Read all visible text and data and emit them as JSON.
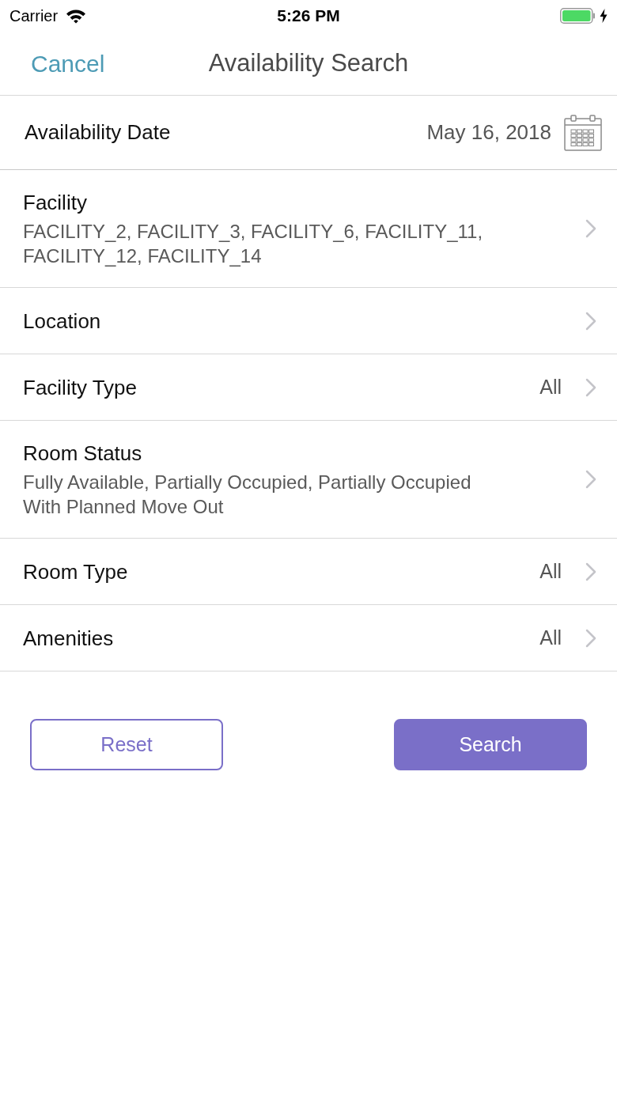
{
  "status_bar": {
    "carrier": "Carrier",
    "time": "5:26 PM"
  },
  "nav": {
    "cancel": "Cancel",
    "title": "Availability Search"
  },
  "date_row": {
    "label": "Availability Date",
    "value": "May 16, 2018"
  },
  "filters": [
    {
      "label": "Facility",
      "detail": "FACILITY_2, FACILITY_3, FACILITY_6, FACILITY_11, FACILITY_12, FACILITY_14"
    },
    {
      "label": "Location"
    },
    {
      "label": "Facility Type",
      "value": "All"
    },
    {
      "label": "Room Status",
      "detail": "Fully Available, Partially Occupied, Partially Occupied With Planned Move Out"
    },
    {
      "label": "Room Type",
      "value": "All"
    },
    {
      "label": "Amenities",
      "value": "All"
    }
  ],
  "buttons": [
    {
      "label": "Reset",
      "kind": "outline"
    },
    {
      "label": "Search",
      "kind": "filled"
    }
  ]
}
